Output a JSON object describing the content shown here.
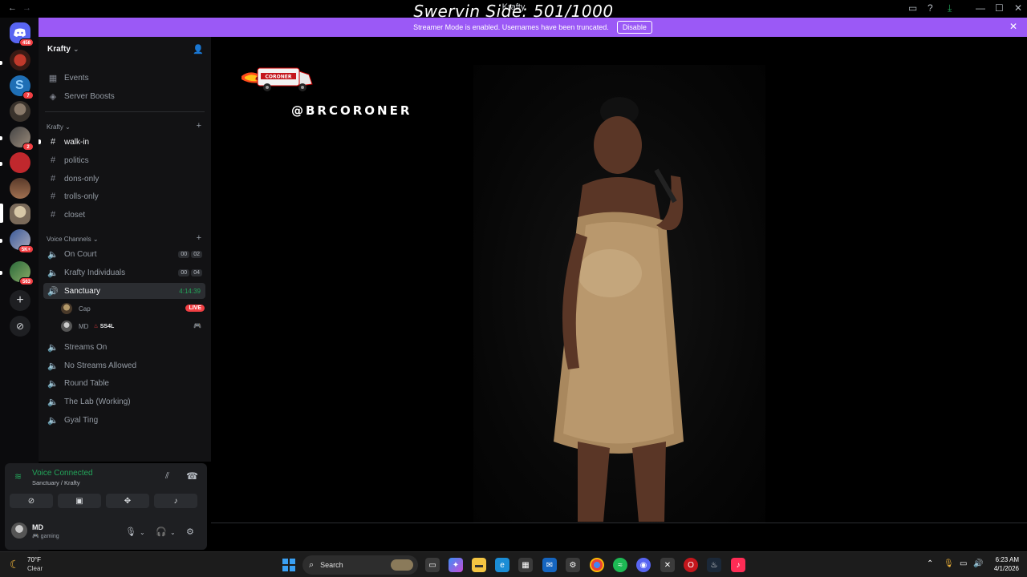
{
  "window": {
    "title": "Krafty",
    "overlay_title": "Swervin Side: 501/1000",
    "nav_back": "←",
    "nav_forward": "→",
    "minimize": "—",
    "maximize": "☐",
    "close": "✕"
  },
  "banner": {
    "message": "Streamer Mode is enabled. Usernames have been truncated.",
    "disable_label": "Disable",
    "color": "#9b59f6"
  },
  "rail": {
    "home_badge": "458",
    "servers": [
      {
        "badge": ""
      },
      {
        "badge": "7"
      },
      {
        "badge": ""
      },
      {
        "badge": "2"
      },
      {
        "badge": ""
      },
      {
        "badge": ""
      },
      {
        "badge": ""
      },
      {
        "badge": "5K+"
      },
      {
        "badge": "563"
      }
    ],
    "add_server": "+",
    "discover": "⊘"
  },
  "sidebar": {
    "guild_name": "Krafty",
    "top_items": [
      {
        "label": "Events",
        "icon": "calendar-icon"
      },
      {
        "label": "Server Boosts",
        "icon": "boost-icon"
      }
    ],
    "text_category": "Krafty",
    "text_channels": [
      "walk-in",
      "politics",
      "dons-only",
      "trolls-only",
      "closet"
    ],
    "voice_category": "Voice Channels",
    "voice_channels": [
      {
        "label": "On Court",
        "count_a": "00",
        "count_b": "02"
      },
      {
        "label": "Krafty Individuals",
        "count_a": "00",
        "count_b": "04"
      },
      {
        "label": "Sanctuary",
        "timer": "4:14:39"
      },
      {
        "label": "Streams On"
      },
      {
        "label": "No Streams Allowed"
      },
      {
        "label": "Round Table"
      },
      {
        "label": "The Lab (Working)"
      },
      {
        "label": "Gyal Ting"
      }
    ],
    "sanctuary_users": [
      {
        "name": "Cap",
        "live": "LIVE"
      },
      {
        "name": "MD",
        "tag": "SS4L"
      }
    ]
  },
  "voice_panel": {
    "status": "Voice Connected",
    "location": "Sanctuary / Krafty",
    "user_name": "MD",
    "user_status": "gaming"
  },
  "stream": {
    "watermark_handle": "@BRCORONER",
    "van_text": "CORONER"
  },
  "taskbar": {
    "weather_temp": "70°F",
    "weather_cond": "Clear",
    "search_placeholder": "Search",
    "time": "6:23 AM",
    "date": "4/1/2026"
  }
}
